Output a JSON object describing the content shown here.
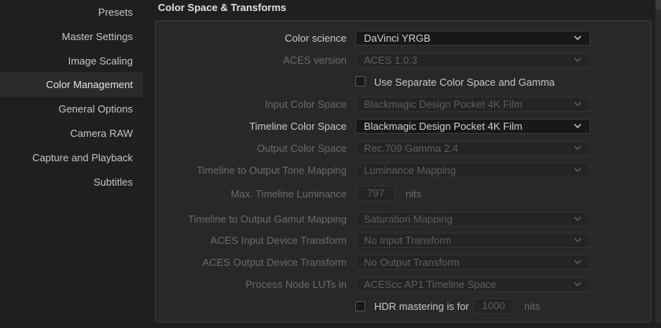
{
  "sidebar": {
    "items": [
      {
        "label": "Presets",
        "active": false
      },
      {
        "label": "Master Settings",
        "active": false
      },
      {
        "label": "Image Scaling",
        "active": false
      },
      {
        "label": "Color Management",
        "active": true
      },
      {
        "label": "General Options",
        "active": false
      },
      {
        "label": "Camera RAW",
        "active": false
      },
      {
        "label": "Capture and Playback",
        "active": false
      },
      {
        "label": "Subtitles",
        "active": false
      }
    ]
  },
  "section": {
    "title": "Color Space & Transforms"
  },
  "fields": {
    "color_science": {
      "label": "Color science",
      "value": "DaVinci YRGB",
      "enabled": true
    },
    "aces_version": {
      "label": "ACES version",
      "value": "ACES 1.0.3",
      "enabled": false
    },
    "separate_color_space": {
      "label": "Use Separate Color Space and Gamma",
      "checked": false
    },
    "input_color_space": {
      "label": "Input Color Space",
      "value": "Blackmagic Design Pocket 4K Film",
      "enabled": false
    },
    "timeline_color_space": {
      "label": "Timeline Color Space",
      "value": "Blackmagic Design Pocket 4K Film",
      "enabled": true
    },
    "output_color_space": {
      "label": "Output Color Space",
      "value": "Rec.709 Gamma 2.4",
      "enabled": false
    },
    "tone_mapping": {
      "label": "Timeline to Output Tone Mapping",
      "value": "Luminance Mapping",
      "enabled": false
    },
    "max_luminance": {
      "label": "Max. Timeline Luminance",
      "value": "797",
      "unit": "nits",
      "enabled": false
    },
    "gamut_mapping": {
      "label": "Timeline to Output Gamut Mapping",
      "value": "Saturation Mapping",
      "enabled": false
    },
    "aces_idt": {
      "label": "ACES Input Device Transform",
      "value": "No Input Transform",
      "enabled": false
    },
    "aces_odt": {
      "label": "ACES Output Device Transform",
      "value": "No Output Transform",
      "enabled": false
    },
    "process_node_luts": {
      "label": "Process Node LUTs in",
      "value": "ACEScc AP1 Timeline Space",
      "enabled": false
    },
    "hdr_mastering": {
      "label": "HDR mastering is for",
      "value": "1000",
      "unit": "nits",
      "checked": false
    }
  },
  "icons": {
    "dropdown": "chevron-down-icon",
    "checkbox": "checkbox-icon"
  },
  "colors": {
    "background": "#1f1f21",
    "panel": "#28282a",
    "active_sidebar": "#2b2b2e",
    "text_enabled": "#c8c8c8",
    "text_disabled": "#6a6a6c"
  }
}
